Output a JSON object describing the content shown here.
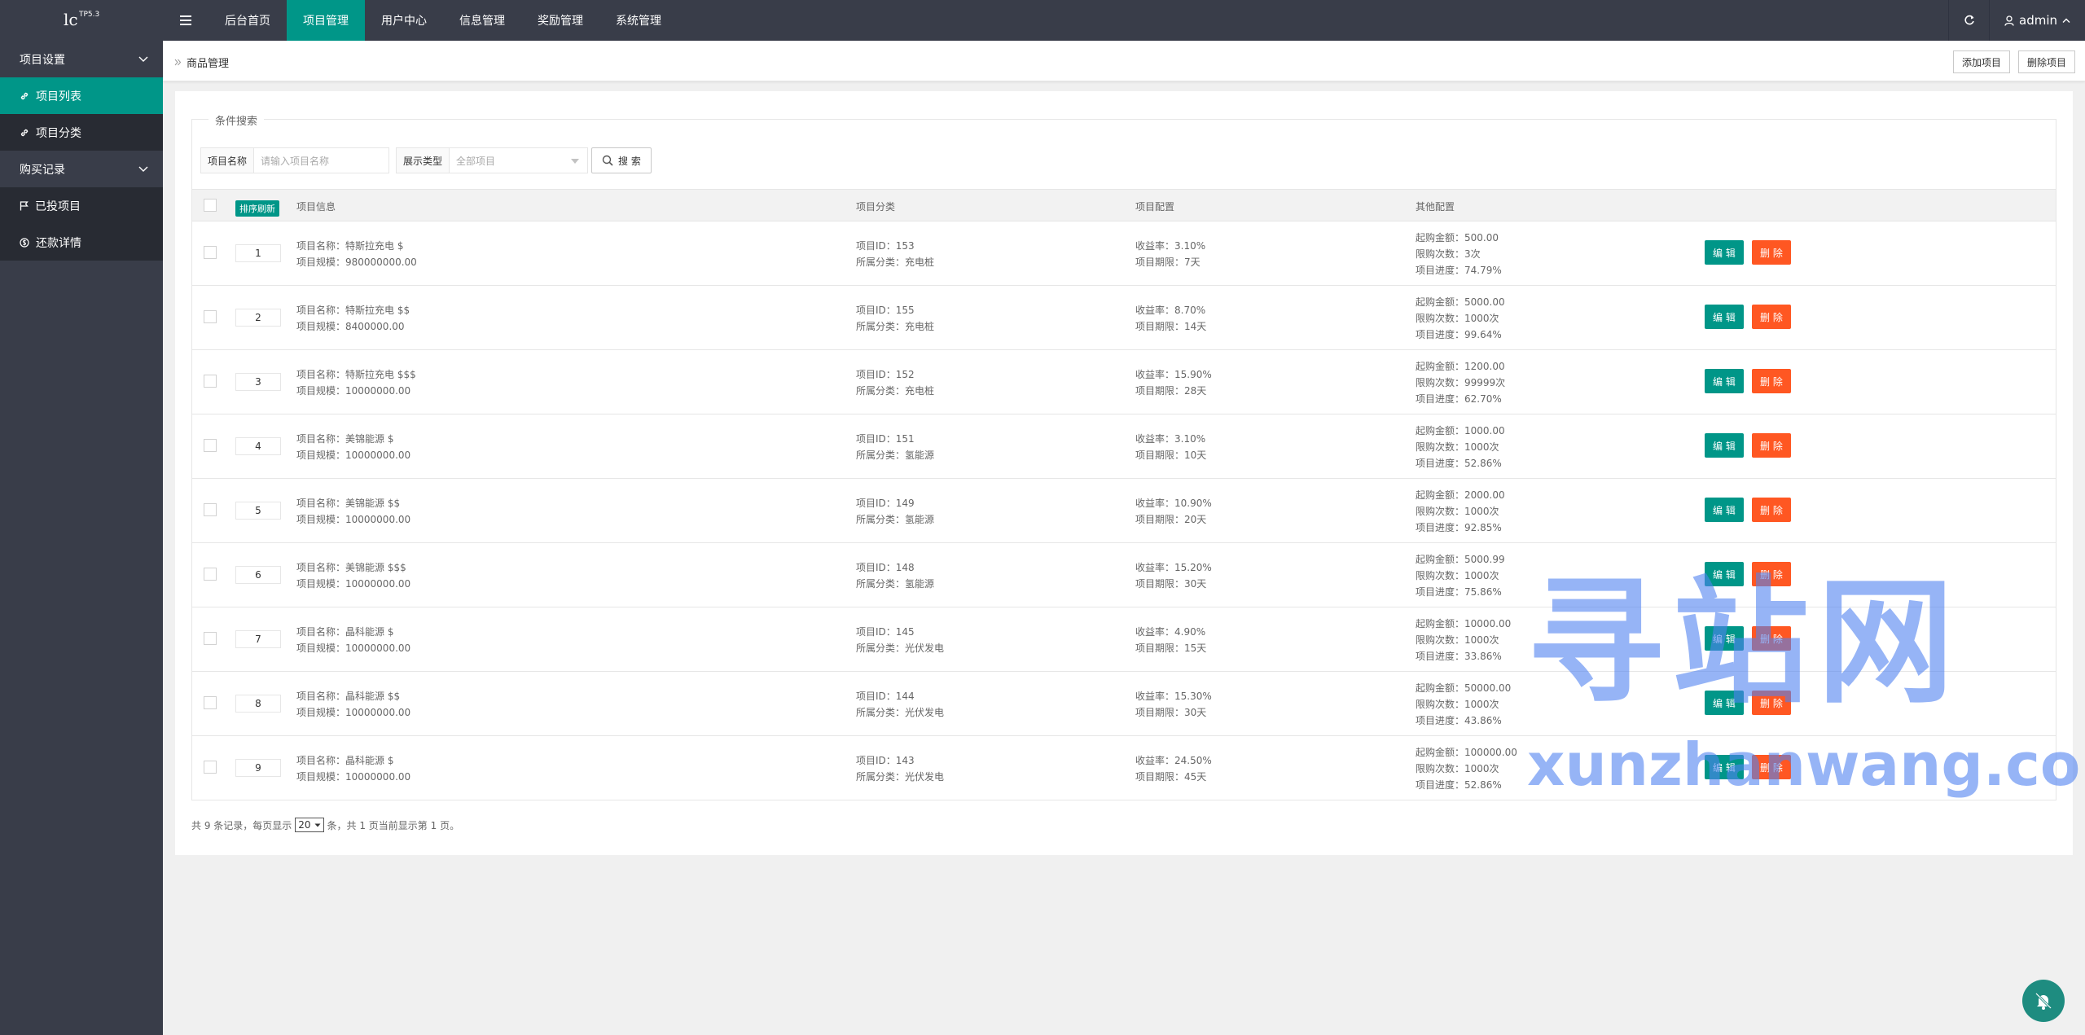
{
  "logo": {
    "text": "lc",
    "version": "TP5.3"
  },
  "topnav": {
    "items": [
      "后台首页",
      "项目管理",
      "用户中心",
      "信息管理",
      "奖励管理",
      "系统管理"
    ],
    "active_index": 1,
    "user": "admin"
  },
  "sidebar": {
    "group1": "项目设置",
    "item_list": "项目列表",
    "item_category": "项目分类",
    "group2": "购买记录",
    "item_invested": "已投项目",
    "item_repay": "还款详情"
  },
  "header": {
    "breadcrumb": "商品管理",
    "add_button": "添加项目",
    "delete_button": "删除项目"
  },
  "search": {
    "legend": "条件搜索",
    "name_label": "项目名称",
    "name_placeholder": "请输入项目名称",
    "type_label": "展示类型",
    "type_value": "全部项目",
    "button": "搜 索"
  },
  "table": {
    "sort_button": "排序刷新",
    "headers": {
      "info": "项目信息",
      "category": "项目分类",
      "config": "项目配置",
      "other": "其他配置"
    },
    "edit_label": "编 辑",
    "delete_label": "删 除",
    "rows": [
      {
        "order": "1",
        "name": "项目名称：特斯拉充电 $",
        "scale": "项目规模：980000000.00",
        "id": "项目ID：153",
        "cat": "所属分类：充电桩",
        "rate": "收益率：3.10%",
        "term": "项目期限：7天",
        "min": "起购金额：500.00",
        "limit": "限购次数：3次",
        "progress": "项目进度：74.79%"
      },
      {
        "order": "2",
        "name": "项目名称：特斯拉充电 $$",
        "scale": "项目规模：8400000.00",
        "id": "项目ID：155",
        "cat": "所属分类：充电桩",
        "rate": "收益率：8.70%",
        "term": "项目期限：14天",
        "min": "起购金额：5000.00",
        "limit": "限购次数：1000次",
        "progress": "项目进度：99.64%"
      },
      {
        "order": "3",
        "name": "项目名称：特斯拉充电 $$$",
        "scale": "项目规模：10000000.00",
        "id": "项目ID：152",
        "cat": "所属分类：充电桩",
        "rate": "收益率：15.90%",
        "term": "项目期限：28天",
        "min": "起购金额：1200.00",
        "limit": "限购次数：99999次",
        "progress": "项目进度：62.70%"
      },
      {
        "order": "4",
        "name": "项目名称：美锦能源 $",
        "scale": "项目规模：10000000.00",
        "id": "项目ID：151",
        "cat": "所属分类：氢能源",
        "rate": "收益率：3.10%",
        "term": "项目期限：10天",
        "min": "起购金额：1000.00",
        "limit": "限购次数：1000次",
        "progress": "项目进度：52.86%"
      },
      {
        "order": "5",
        "name": "项目名称：美锦能源 $$",
        "scale": "项目规模：10000000.00",
        "id": "项目ID：149",
        "cat": "所属分类：氢能源",
        "rate": "收益率：10.90%",
        "term": "项目期限：20天",
        "min": "起购金额：2000.00",
        "limit": "限购次数：1000次",
        "progress": "项目进度：92.85%"
      },
      {
        "order": "6",
        "name": "项目名称：美锦能源 $$$",
        "scale": "项目规模：10000000.00",
        "id": "项目ID：148",
        "cat": "所属分类：氢能源",
        "rate": "收益率：15.20%",
        "term": "项目期限：30天",
        "min": "起购金额：5000.99",
        "limit": "限购次数：1000次",
        "progress": "项目进度：75.86%"
      },
      {
        "order": "7",
        "name": "项目名称：晶科能源 $",
        "scale": "项目规模：10000000.00",
        "id": "项目ID：145",
        "cat": "所属分类：光伏发电",
        "rate": "收益率：4.90%",
        "term": "项目期限：15天",
        "min": "起购金额：10000.00",
        "limit": "限购次数：1000次",
        "progress": "项目进度：33.86%"
      },
      {
        "order": "8",
        "name": "项目名称：晶科能源 $$",
        "scale": "项目规模：10000000.00",
        "id": "项目ID：144",
        "cat": "所属分类：光伏发电",
        "rate": "收益率：15.30%",
        "term": "项目期限：30天",
        "min": "起购金额：50000.00",
        "limit": "限购次数：1000次",
        "progress": "项目进度：43.86%"
      },
      {
        "order": "9",
        "name": "项目名称：晶科能源 $",
        "scale": "项目规模：10000000.00",
        "id": "项目ID：143",
        "cat": "所属分类：光伏发电",
        "rate": "收益率：24.50%",
        "term": "项目期限：45天",
        "min": "起购金额：100000.00",
        "limit": "限购次数：1000次",
        "progress": "项目进度：52.86%"
      }
    ]
  },
  "pager": {
    "prefix": "共 9 条记录，每页显示",
    "page_size": "20",
    "suffix": "条，共 1 页当前显示第 1 页。"
  },
  "watermark": {
    "big": "寻站网",
    "small": "xunzhanwang.com"
  },
  "colors": {
    "accent": "#009688",
    "danger": "#ff5722",
    "dark": "#393d49"
  }
}
